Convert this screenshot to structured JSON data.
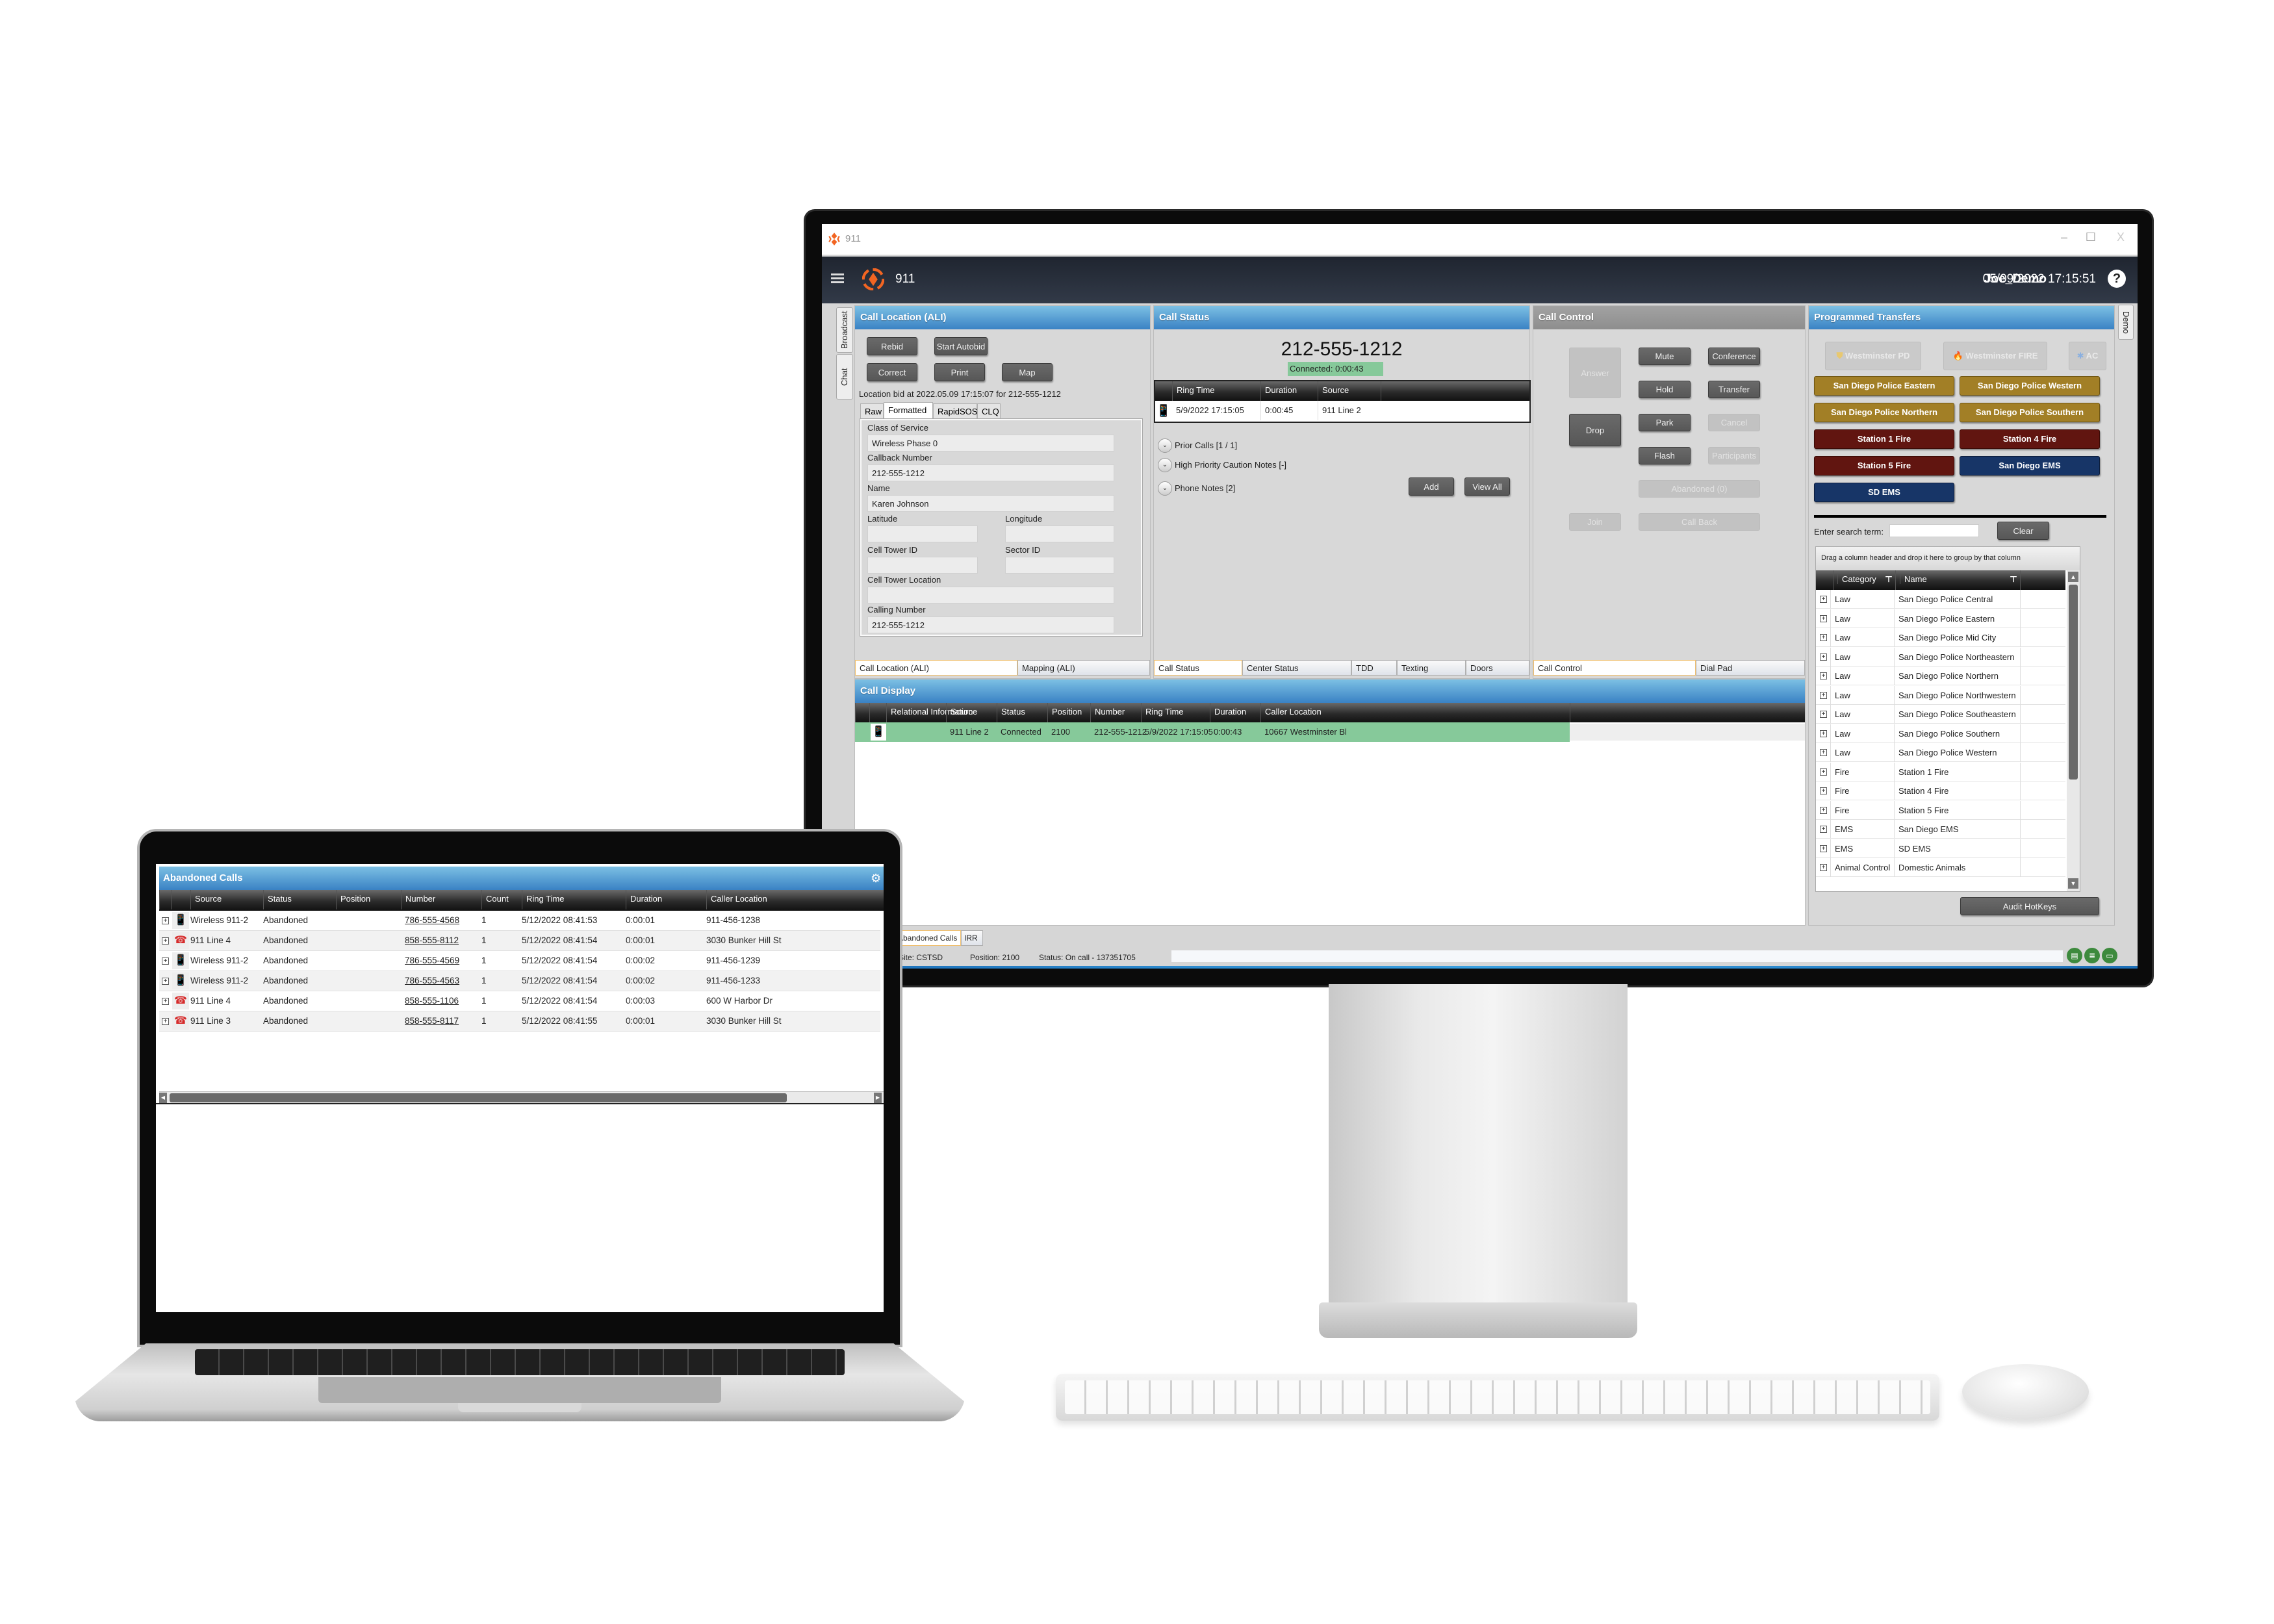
{
  "window": {
    "title": "911",
    "minimize": "–",
    "maximize": "☐",
    "close": "X"
  },
  "header": {
    "title": "911",
    "user": "Joe_Demo",
    "datetime": "05/09/2022 17:15:51",
    "help": "?"
  },
  "side_tabs": {
    "left": [
      "Broadcast",
      "Chat"
    ],
    "right": [
      "Demo"
    ]
  },
  "call_location": {
    "title": "Call Location (ALI)",
    "buttons": [
      "Rebid",
      "Start Autobid",
      "Correct",
      "Print",
      "Map"
    ],
    "bid_info": "Location bid at 2022.05.09 17:15:07 for 212-555-1212",
    "tabs": [
      "Raw",
      "Formatted",
      "RapidSOS",
      "CLQ"
    ],
    "active_tab": "Formatted",
    "fields": {
      "class_of_service": {
        "label": "Class of Service",
        "value": "Wireless Phase 0"
      },
      "callback_number": {
        "label": "Callback Number",
        "value": "212-555-1212"
      },
      "name": {
        "label": "Name",
        "value": "Karen Johnson"
      },
      "latitude": {
        "label": "Latitude",
        "value": ""
      },
      "longitude": {
        "label": "Longitude",
        "value": ""
      },
      "cell_tower_id": {
        "label": "Cell Tower ID",
        "value": ""
      },
      "sector_id": {
        "label": "Sector ID",
        "value": ""
      },
      "cell_tower_location": {
        "label": "Cell Tower Location",
        "value": ""
      },
      "calling_number": {
        "label": "Calling Number",
        "value": "212-555-1212"
      }
    },
    "footer_tabs": [
      "Call Location (ALI)",
      "Mapping (ALI)"
    ]
  },
  "call_status": {
    "title": "Call Status",
    "number": "212-555-1212",
    "connected": "Connected: 0:00:43",
    "grid_headers": [
      "Ring Time",
      "Duration",
      "Source"
    ],
    "grid_row": {
      "ring_time": "5/9/2022 17:15:05",
      "duration": "0:00:45",
      "source": "911 Line 2",
      "icon": "cell-phone-icon"
    },
    "sections": [
      "Prior Calls [1 / 1]",
      "High Priority Caution Notes [-]",
      "Phone Notes [2]"
    ],
    "buttons": [
      "Add",
      "View All"
    ],
    "footer_tabs": [
      "Call Status",
      "Center Status",
      "TDD",
      "Texting",
      "Doors"
    ]
  },
  "call_control": {
    "title": "Call Control",
    "buttons": {
      "answer": {
        "label": "Answer",
        "enabled": false
      },
      "mute": {
        "label": "Mute",
        "enabled": true
      },
      "conference": {
        "label": "Conference",
        "enabled": true
      },
      "hold": {
        "label": "Hold",
        "enabled": true
      },
      "transfer": {
        "label": "Transfer",
        "enabled": true
      },
      "drop": {
        "label": "Drop",
        "enabled": true
      },
      "park": {
        "label": "Park",
        "enabled": true
      },
      "cancel": {
        "label": "Cancel",
        "enabled": false
      },
      "flash": {
        "label": "Flash",
        "enabled": true
      },
      "participants": {
        "label": "Participants",
        "enabled": false
      },
      "abandoned": {
        "label": "Abandoned (0)",
        "enabled": false
      },
      "join": {
        "label": "Join",
        "enabled": false
      },
      "call_back": {
        "label": "Call Back",
        "enabled": false
      }
    },
    "footer_tabs": [
      "Call Control",
      "Dial Pad"
    ]
  },
  "programmed_transfers": {
    "title": "Programmed Transfers",
    "disabled_row": [
      "Westminster PD",
      "Westminster FIRE",
      "AC"
    ],
    "buttons": [
      {
        "label": "San Diego Police Eastern",
        "color": "#a27f26"
      },
      {
        "label": "San Diego Police Western",
        "color": "#a27f26"
      },
      {
        "label": "San Diego Police Northern",
        "color": "#a27f26"
      },
      {
        "label": "San Diego Police Southern",
        "color": "#a27f26"
      },
      {
        "label": "Station 1 Fire",
        "color": "#611510"
      },
      {
        "label": "Station 4 Fire",
        "color": "#611510"
      },
      {
        "label": "Station 5 Fire",
        "color": "#611510"
      },
      {
        "label": "San Diego EMS",
        "color": "#173567"
      },
      {
        "label": "SD EMS",
        "color": "#173567"
      }
    ],
    "search_label": "Enter search term:",
    "search_value": "",
    "clear": "Clear",
    "group_hint": "Drag a column header and drop it here to group by that column",
    "grid_headers": [
      "Category",
      "Name"
    ],
    "rows": [
      [
        "Law",
        "San Diego Police Central"
      ],
      [
        "Law",
        "San Diego Police Eastern"
      ],
      [
        "Law",
        "San Diego Police Mid City"
      ],
      [
        "Law",
        "San Diego Police Northeastern"
      ],
      [
        "Law",
        "San Diego Police Northern"
      ],
      [
        "Law",
        "San Diego Police Northwestern"
      ],
      [
        "Law",
        "San Diego Police Southeastern"
      ],
      [
        "Law",
        "San Diego Police Southern"
      ],
      [
        "Law",
        "San Diego Police Western"
      ],
      [
        "Fire",
        "Station 1 Fire"
      ],
      [
        "Fire",
        "Station 4 Fire"
      ],
      [
        "Fire",
        "Station 5 Fire"
      ],
      [
        "EMS",
        "San Diego EMS"
      ],
      [
        "EMS",
        "SD EMS"
      ],
      [
        "Animal Control",
        "Domestic Animals"
      ]
    ],
    "audit": "Audit HotKeys"
  },
  "call_display": {
    "title": "Call Display",
    "headers": [
      "Relational Information",
      "Source",
      "Status",
      "Position",
      "Number",
      "Ring Time",
      "Duration",
      "Caller Location"
    ],
    "rows": [
      {
        "relational": "",
        "source": "911 Line 2",
        "status": "Connected",
        "position": "2100",
        "number": "212-555-1212",
        "ring_time": "5/9/2022 17:15:05",
        "duration": "0:00:43",
        "caller_location": "10667 Westminster Bl",
        "icon": "cell-phone-icon",
        "highlight": "#86c99a"
      }
    ]
  },
  "bottom_tabs": [
    "Abandoned Calls",
    "IRR"
  ],
  "status_bar": {
    "site": "Site: CSTSD",
    "position": "Position: 2100",
    "status": "Status: On call - 137351705",
    "icons": [
      "server-status-icon",
      "database-status-icon",
      "workstation-status-icon"
    ],
    "icon_color": "#3d8a3d"
  },
  "laptop": {
    "title": "Abandoned Calls",
    "headers": [
      "Source",
      "Status",
      "Position",
      "Number",
      "Count",
      "Ring Time",
      "Duration",
      "Caller Location"
    ],
    "rows": [
      {
        "icon": "cell-phone-icon",
        "source": "Wireless 911-2",
        "status": "Abandoned",
        "position": "",
        "number": "786-555-4568",
        "count": "1",
        "ring_time": "5/12/2022 08:41:53",
        "duration": "0:00:01",
        "caller_location": "911-456-1238"
      },
      {
        "icon": "landline-phone-icon",
        "source": "911 Line 4",
        "status": "Abandoned",
        "position": "",
        "number": "858-555-8112",
        "count": "1",
        "ring_time": "5/12/2022 08:41:54",
        "duration": "0:00:01",
        "caller_location": "3030 Bunker Hill St"
      },
      {
        "icon": "cell-phone-icon",
        "source": "Wireless 911-2",
        "status": "Abandoned",
        "position": "",
        "number": "786-555-4569",
        "count": "1",
        "ring_time": "5/12/2022 08:41:54",
        "duration": "0:00:02",
        "caller_location": "911-456-1239"
      },
      {
        "icon": "cell-phone-icon",
        "source": "Wireless 911-2",
        "status": "Abandoned",
        "position": "",
        "number": "786-555-4563",
        "count": "1",
        "ring_time": "5/12/2022 08:41:54",
        "duration": "0:00:02",
        "caller_location": "911-456-1233"
      },
      {
        "icon": "landline-phone-icon",
        "source": "911 Line 4",
        "status": "Abandoned",
        "position": "",
        "number": "858-555-1106",
        "count": "1",
        "ring_time": "5/12/2022 08:41:54",
        "duration": "0:00:03",
        "caller_location": "600 W Harbor Dr"
      },
      {
        "icon": "landline-phone-icon",
        "source": "911 Line 3",
        "status": "Abandoned",
        "position": "",
        "number": "858-555-8117",
        "count": "1",
        "ring_time": "5/12/2022 08:41:55",
        "duration": "0:00:01",
        "caller_location": "3030 Bunker Hill St"
      }
    ]
  },
  "colors": {
    "accent_blue": "#3a82c4",
    "connected_green": "#86c99a",
    "brand_orange": "#f26522"
  }
}
